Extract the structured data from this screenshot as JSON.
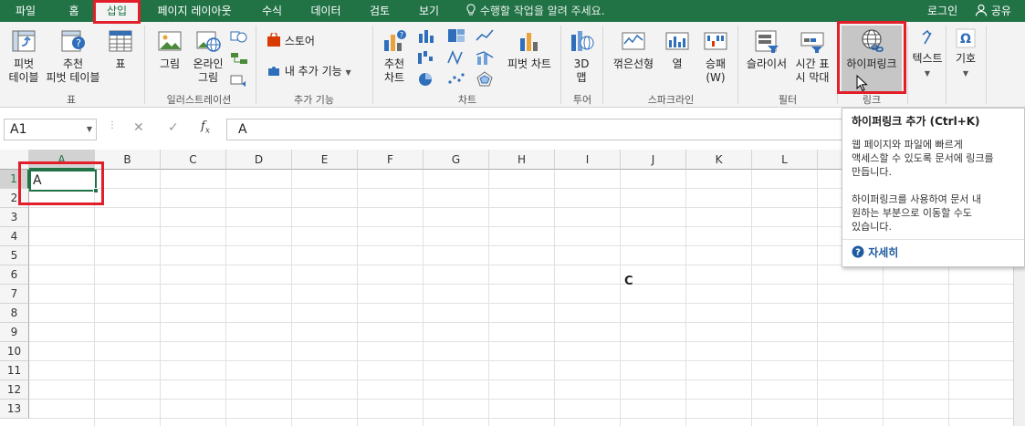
{
  "tabs": [
    "파일",
    "홈",
    "삽입",
    "페이지 레이아웃",
    "수식",
    "데이터",
    "검토",
    "보기"
  ],
  "tell_me": "수행할 작업을 알려 주세요.",
  "login": "로그인",
  "share": "공유",
  "ribbon": {
    "pivot_table": [
      "피벗",
      "테이블"
    ],
    "rec_pivot": [
      "추천",
      "피벗 테이블"
    ],
    "table": "표",
    "group_tables": "표",
    "picture": "그림",
    "online_picture": [
      "온라인",
      "그림"
    ],
    "group_illust": "일러스트레이션",
    "store": "스토어",
    "my_addins": "내 추가 기능",
    "group_addins": "추가 기능",
    "rec_charts": [
      "추천",
      "차트"
    ],
    "pivot_chart": "피벗 차트",
    "group_charts": "차트",
    "map3d": [
      "3D",
      "맵"
    ],
    "group_tours": "투어",
    "line": "꺾은선형",
    "column": "열",
    "winloss": [
      "승패",
      "(W)"
    ],
    "group_spark": "스파크라인",
    "slicer": "슬라이서",
    "timeline": [
      "시간 표",
      "시 막대"
    ],
    "group_filters": "필터",
    "hyperlink": "하이퍼링크",
    "group_links": "링크",
    "text": "텍스트",
    "symbols": "기호"
  },
  "name_box": "A1",
  "formula_value": "A",
  "columns": [
    "A",
    "B",
    "C",
    "D",
    "E",
    "F",
    "G",
    "H",
    "I",
    "J",
    "K",
    "L"
  ],
  "rows": [
    "1",
    "2",
    "3",
    "4",
    "5",
    "6",
    "7",
    "8",
    "9",
    "10",
    "11",
    "12",
    "13"
  ],
  "cell_a1": "A",
  "cell_c": "C",
  "tooltip": {
    "title": "하이퍼링크 추가 (Ctrl+K)",
    "p1": [
      "웹 페이지와 파일에 빠르게",
      "액세스할 수 있도록 문서에 링크를",
      "만듭니다."
    ],
    "p2": [
      "하이퍼링크를 사용하여 문서 내",
      "원하는 부분으로 이동할 수도",
      "있습니다."
    ],
    "more": "자세히"
  },
  "colors": {
    "accent": "#217346",
    "highlight": "#e21e2b",
    "link_icon": "#1f5fa8"
  }
}
